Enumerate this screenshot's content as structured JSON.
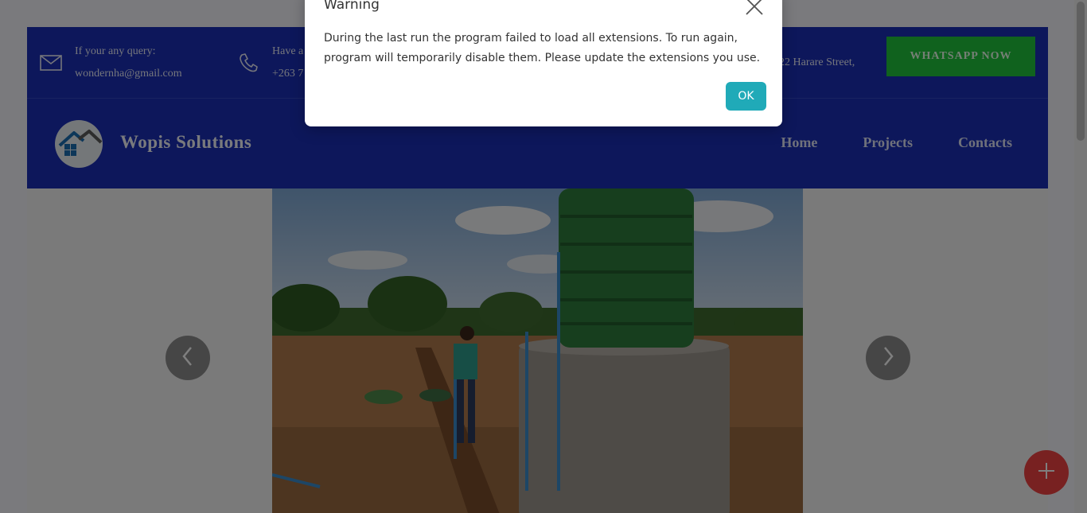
{
  "topbar": {
    "email_label": "If your any query:",
    "email_value": "wondernha@gmail.com",
    "phone_label": "Have a",
    "phone_value": "+263 7",
    "address": "22 Harare Street,",
    "whatsapp_button": "WHATSAPP NOW"
  },
  "header": {
    "brand": "Wopis Solutions",
    "nav": [
      "Home",
      "Projects",
      "Contacts"
    ]
  },
  "icons": {
    "email": "envelope-icon",
    "phone": "phone-icon",
    "prev": "chevron-left-icon",
    "next": "chevron-right-icon",
    "fab": "plus-icon",
    "close": "close-icon"
  },
  "colors": {
    "brand_blue": "#1a2fb7",
    "whatsapp_green": "#20c53d",
    "ok_teal": "#20aab8",
    "fab_red": "#f04242"
  },
  "dialog": {
    "title": "Warning",
    "message": "During the last run the program failed to load all extensions. To run again, program will temporarily disable them. Please update the extensions you use.",
    "ok_label": "OK"
  }
}
